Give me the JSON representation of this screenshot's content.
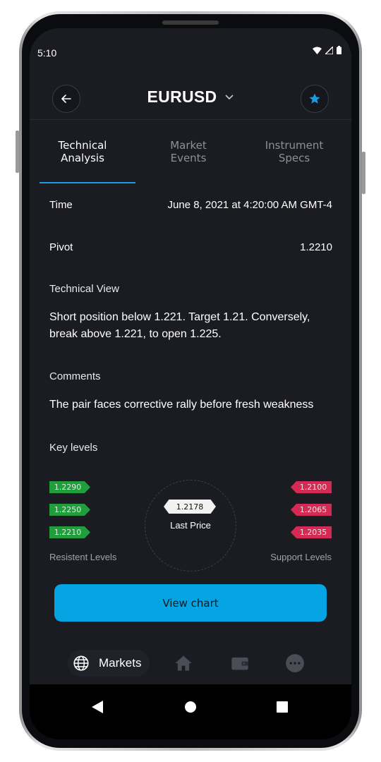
{
  "status_bar": {
    "time": "5:10"
  },
  "header": {
    "title": "EURUSD"
  },
  "tabs": [
    {
      "line1": "Technical",
      "line2": "Analysis",
      "active": true
    },
    {
      "line1": "Market",
      "line2": "Events",
      "active": false
    },
    {
      "line1": "Instrument",
      "line2": "Specs",
      "active": false
    }
  ],
  "details": {
    "time_label": "Time",
    "time_value": "June 8, 2021 at 4:20:00 AM GMT-4",
    "pivot_label": "Pivot",
    "pivot_value": "1.2210",
    "technical_view_label": "Technical View",
    "technical_view_text": "Short position below 1.221. Target 1.21. Conversely, break above 1.221, to open 1.225.",
    "comments_label": "Comments",
    "comments_text": "The pair faces corrective rally before fresh weakness",
    "key_levels_label": "Key levels"
  },
  "key_levels": {
    "resistance": [
      "1.2290",
      "1.2250",
      "1.2210"
    ],
    "support": [
      "1.2100",
      "1.2065",
      "1.2035"
    ],
    "last_price": "1.2178",
    "last_price_label": "Last Price",
    "resistance_label": "Resistent Levels",
    "support_label": "Support Levels"
  },
  "actions": {
    "view_chart": "View chart"
  },
  "bottom_nav": {
    "markets_label": "Markets"
  },
  "colors": {
    "accent": "#05a5e3",
    "green": "#1f9e3b",
    "red": "#d42b55",
    "background": "#1b1c22"
  }
}
